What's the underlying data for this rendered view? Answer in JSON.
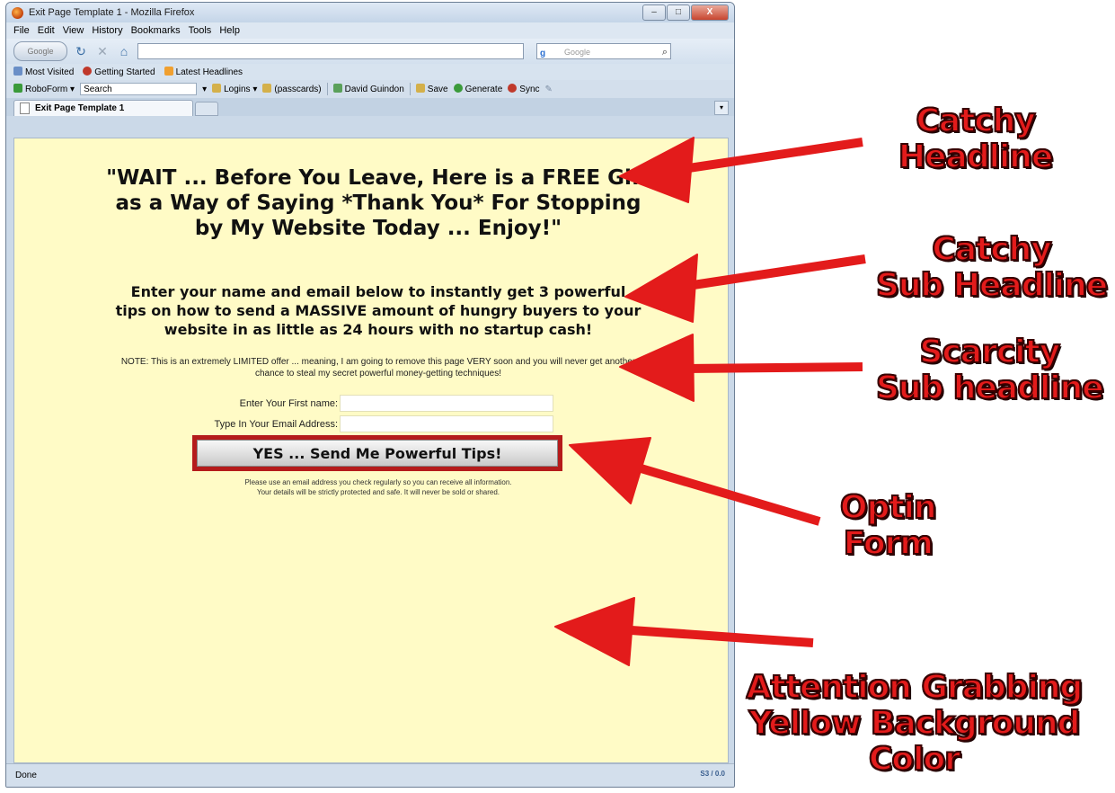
{
  "browser": {
    "title": "Exit Page Template 1 - Mozilla Firefox",
    "window_controls": {
      "minimize": "–",
      "maximize": "□",
      "close": "X"
    },
    "menu": [
      "File",
      "Edit",
      "View",
      "History",
      "Bookmarks",
      "Tools",
      "Help"
    ],
    "nav": {
      "back_label": "Google"
    },
    "search_placeholder": "Google",
    "bookmarks": [
      "Most Visited",
      "Getting Started",
      "Latest Headlines"
    ],
    "roboform": {
      "label": "RoboForm",
      "search": "Search",
      "items": [
        "Logins",
        "(passcards)",
        "David Guindon",
        "Save",
        "Generate",
        "Sync"
      ]
    },
    "tab_title": "Exit Page Template 1",
    "status": "Done",
    "status_right": "S3 / 0.0"
  },
  "page": {
    "background_color": "#fffbc6",
    "headline": "\"WAIT ... Before You Leave, Here is a FREE Gift as a Way of Saying *Thank You* For Stopping by My Website Today ... Enjoy!\"",
    "subheadline": "Enter your name and email below to instantly get 3 powerful tips on how to send a MASSIVE amount of hungry buyers to your website in as little as 24 hours with no startup cash!",
    "note": "NOTE: This is an extremely LIMITED offer ... meaning, I am going to remove this page VERY soon and you will never get another chance to steal my secret powerful money-getting techniques!",
    "form": {
      "first_name_label": "Enter Your First name:",
      "email_label": "Type In Your Email Address:",
      "submit_label": "YES ... Send Me Powerful Tips!",
      "disclaimer_line1": "Please use an email address you check regularly so you can receive all information.",
      "disclaimer_line2": "Your details will be strictly protected and safe. It will never be sold or shared."
    }
  },
  "annotations": {
    "color": "#e31b1b",
    "headline": [
      "Catchy",
      "Headline"
    ],
    "subheadline": [
      "Catchy",
      "Sub Headline"
    ],
    "scarcity": [
      "Scarcity",
      "Sub headline"
    ],
    "optin": [
      "Optin",
      "Form"
    ],
    "background": [
      "Attention Grabbing",
      "Yellow Background",
      "Color"
    ]
  }
}
